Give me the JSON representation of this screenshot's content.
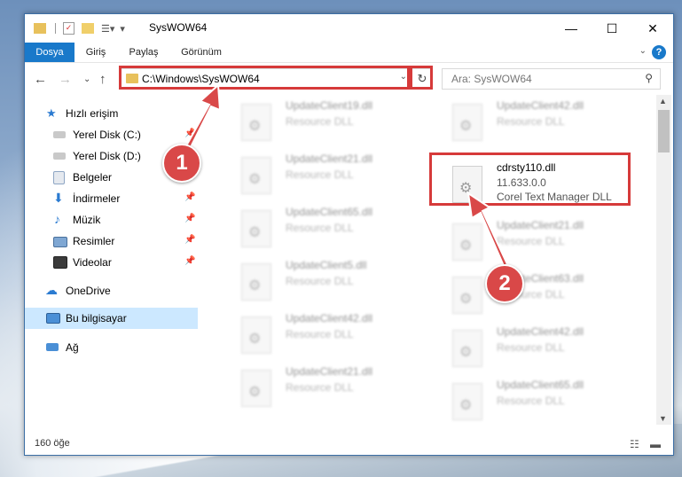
{
  "window": {
    "title": "SysWOW64",
    "controls": {
      "minimize": "—",
      "maximize": "☐",
      "close": "✕"
    }
  },
  "ribbon": {
    "tabs": [
      "Dosya",
      "Giriş",
      "Paylaş",
      "Görünüm"
    ],
    "help": "?"
  },
  "nav": {
    "address": "C:\\Windows\\SysWOW64",
    "search_placeholder": "Ara: SysWOW64"
  },
  "sidebar": {
    "items": [
      {
        "label": "Hızlı erişim",
        "icon": "star-icon"
      },
      {
        "label": "Yerel Disk (C:)",
        "icon": "drive-icon"
      },
      {
        "label": "Yerel Disk (D:)",
        "icon": "drive-icon"
      },
      {
        "label": "Belgeler",
        "icon": "documents-icon"
      },
      {
        "label": "İndirmeler",
        "icon": "download-icon"
      },
      {
        "label": "Müzik",
        "icon": "music-icon"
      },
      {
        "label": "Resimler",
        "icon": "pictures-icon"
      },
      {
        "label": "Videolar",
        "icon": "videos-icon"
      },
      {
        "label": "OneDrive",
        "icon": "cloud-icon"
      },
      {
        "label": "Bu bilgisayar",
        "icon": "computer-icon"
      },
      {
        "label": "Ağ",
        "icon": "network-icon"
      }
    ]
  },
  "files": {
    "left_column": [
      {
        "name": "UpdateClient19.dll",
        "desc": "Resource DLL"
      },
      {
        "name": "UpdateClient21.dll",
        "desc": "Resource DLL"
      },
      {
        "name": "UpdateClient65.dll",
        "desc": "Resource DLL"
      },
      {
        "name": "UpdateClient5.dll",
        "desc": "Resource DLL"
      },
      {
        "name": "UpdateClient42.dll",
        "desc": "Resource DLL"
      },
      {
        "name": "UpdateClient21.dll",
        "desc": "Resource DLL"
      }
    ],
    "right_column": [
      {
        "name": "UpdateClient42.dll",
        "desc": "Resource DLL"
      },
      {
        "name": "UpdateClient21.dll",
        "desc": "Resource DLL"
      },
      {
        "name": "UpdateClient63.dll",
        "desc": "Resource DLL"
      },
      {
        "name": "UpdateClient42.dll",
        "desc": "Resource DLL"
      },
      {
        "name": "UpdateClient65.dll",
        "desc": "Resource DLL"
      }
    ],
    "highlighted": {
      "name": "cdrsty110.dll",
      "version": "11.633.0.0",
      "desc": "Corel Text Manager DLL"
    }
  },
  "status": {
    "count": "160 öğe"
  },
  "annotations": {
    "marker1": "1",
    "marker2": "2",
    "color": "#d94848"
  }
}
